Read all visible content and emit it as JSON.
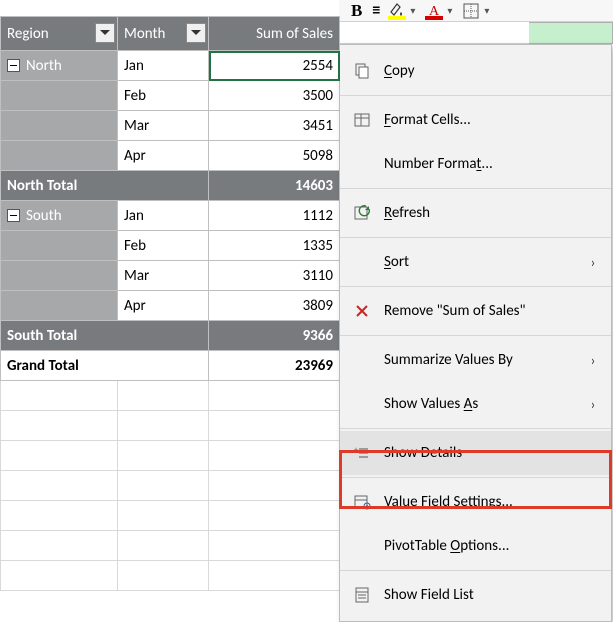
{
  "pivot": {
    "headers": {
      "region": "Region",
      "month": "Month",
      "sales": "Sum of Sales"
    },
    "groups": [
      {
        "region": "North",
        "rows": [
          {
            "month": "Jan",
            "sales": "2554"
          },
          {
            "month": "Feb",
            "sales": "3500"
          },
          {
            "month": "Mar",
            "sales": "3451"
          },
          {
            "month": "Apr",
            "sales": "5098"
          }
        ],
        "subtotal_label": "North Total",
        "subtotal_value": "14603"
      },
      {
        "region": "South",
        "rows": [
          {
            "month": "Jan",
            "sales": "1112"
          },
          {
            "month": "Feb",
            "sales": "1335"
          },
          {
            "month": "Mar",
            "sales": "3110"
          },
          {
            "month": "Apr",
            "sales": "3809"
          }
        ],
        "subtotal_label": "South Total",
        "subtotal_value": "9366"
      }
    ],
    "grand_label": "Grand Total",
    "grand_value": "23969"
  },
  "menu": {
    "copy": "Copy",
    "format_cells": "Format Cells...",
    "number_format": "Number Format...",
    "refresh": "Refresh",
    "sort": "Sort",
    "remove": "Remove \"Sum of Sales\"",
    "summarize": "Summarize Values By",
    "show_values_as": "Show Values As",
    "show_details": "Show Details",
    "value_field_settings": "Value Field Settings...",
    "pivot_options": "PivotTable Options...",
    "show_field_list": "Show Field List"
  },
  "mnemonic": {
    "copy": "C",
    "format_cells": "F",
    "number_format": "t",
    "refresh": "R",
    "sort": "S",
    "remove": "V",
    "summarize": "M",
    "show_values_as": "A",
    "show_details": "E",
    "value_field_settings": "N",
    "pivot_options": "O",
    "show_field_list": "D"
  }
}
